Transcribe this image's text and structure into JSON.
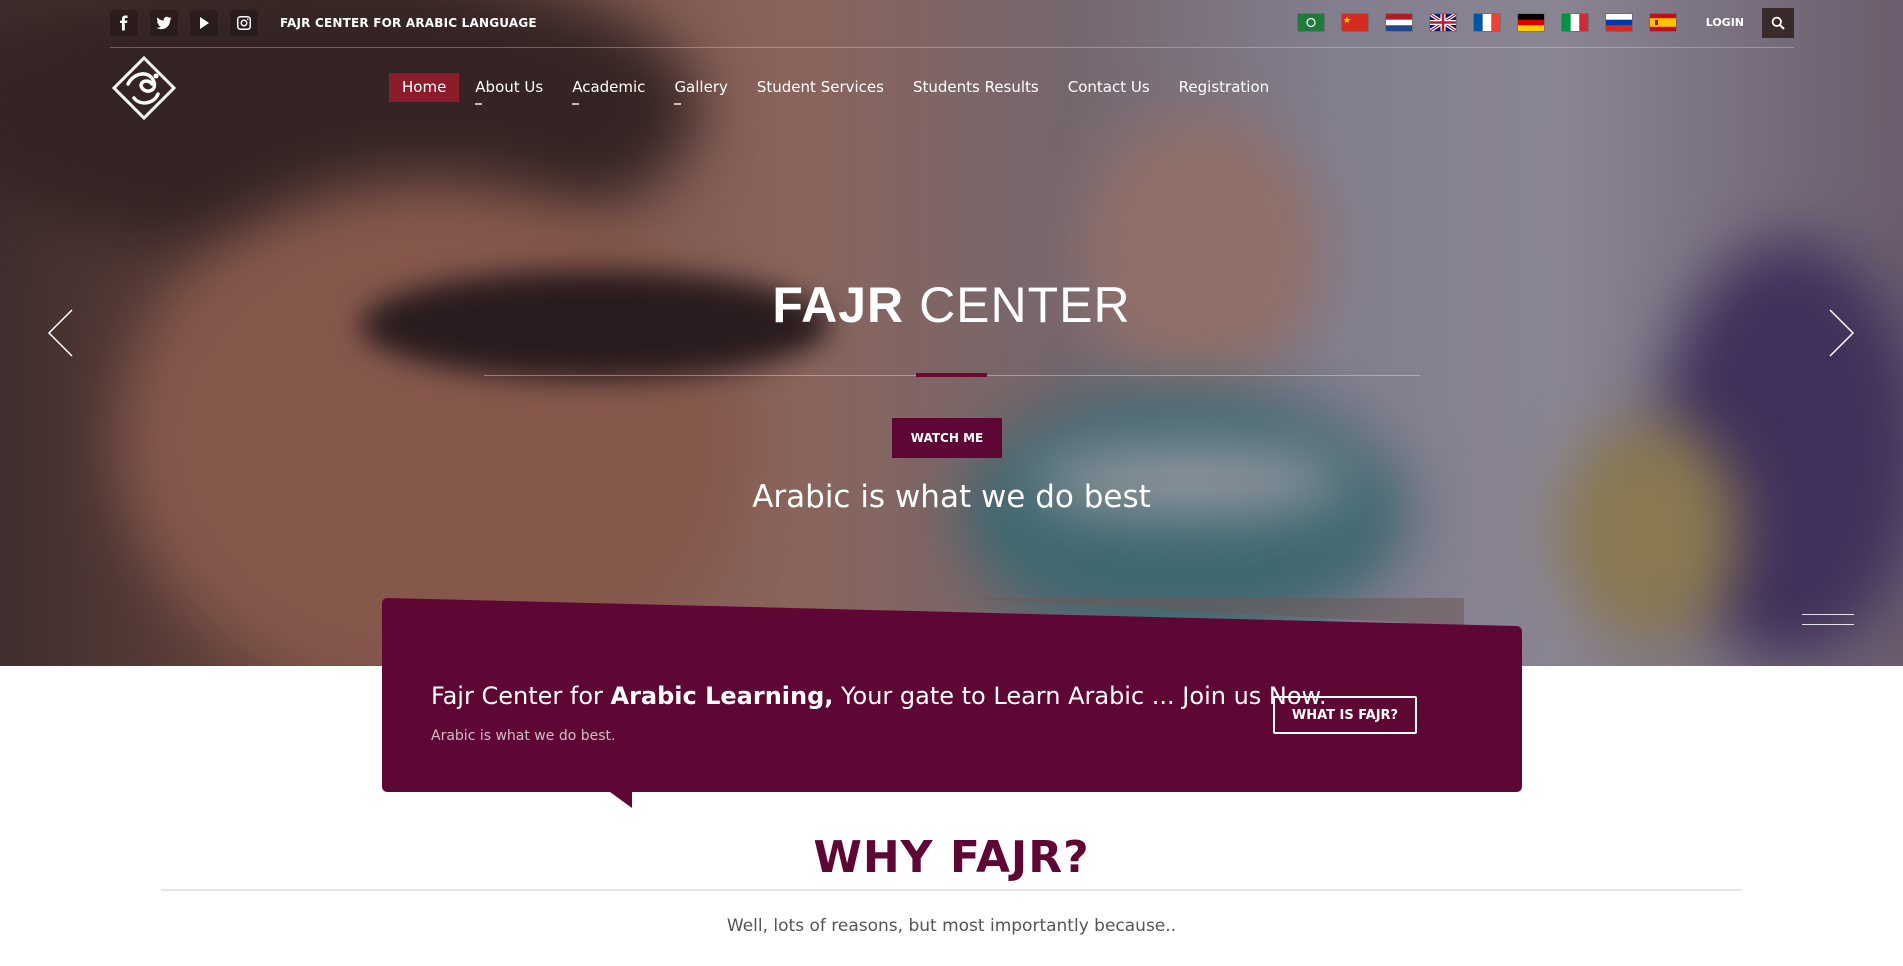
{
  "topbar": {
    "title": "FAJR CENTER FOR ARABIC LANGUAGE",
    "social": [
      {
        "name": "facebook-icon"
      },
      {
        "name": "twitter-icon"
      },
      {
        "name": "youtube-icon"
      },
      {
        "name": "instagram-icon"
      }
    ],
    "flags": [
      "arabic",
      "chinese",
      "dutch",
      "english",
      "french",
      "german",
      "italian",
      "russian",
      "spanish"
    ],
    "login_label": "LOGIN"
  },
  "nav": {
    "items": [
      {
        "label": "Home",
        "active": true
      },
      {
        "label": "About Us"
      },
      {
        "label": "Academic"
      },
      {
        "label": "Gallery"
      },
      {
        "label": "Student Services"
      },
      {
        "label": "Students Results"
      },
      {
        "label": "Contact Us"
      },
      {
        "label": "Registration"
      }
    ]
  },
  "hero": {
    "title_bold": "FAJR",
    "title_rest": "CENTER",
    "watch_label": "WATCH ME",
    "subtitle": "Arabic is what we do best"
  },
  "promo": {
    "text_start": "Fajr Center for ",
    "text_bold": "Arabic Learning,",
    "text_end": " Your gate to Learn Arabic ... Join us Now.",
    "subtext": "Arabic is what we do best.",
    "button_label": "WHAT IS FAJR?"
  },
  "why": {
    "title": "WHY FAJR?",
    "subtitle": "Well, lots of reasons, but most importantly because.."
  },
  "colors": {
    "brand": "#5e0634",
    "nav_active": "#8c1c2a"
  }
}
